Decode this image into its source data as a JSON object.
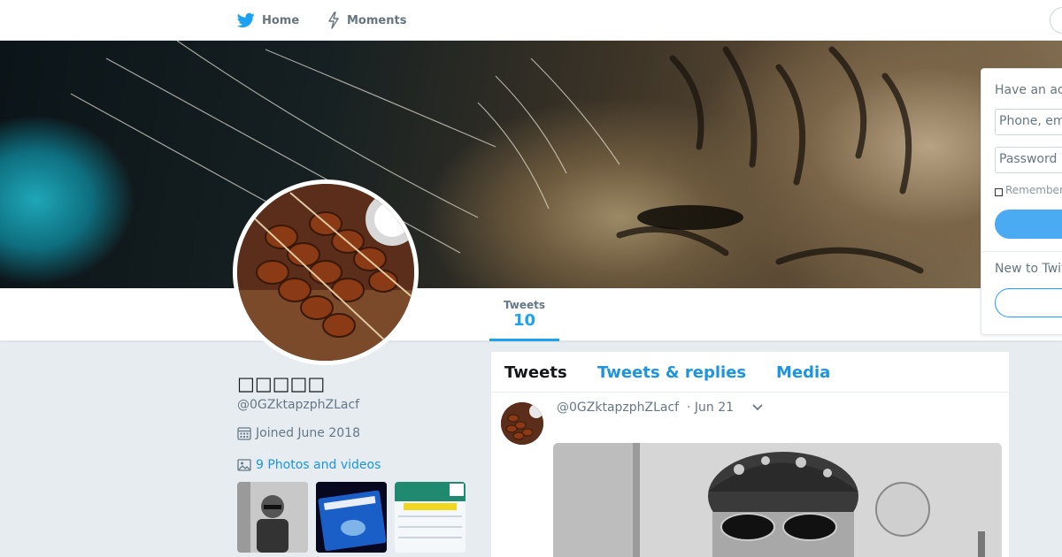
{
  "nav": {
    "home_label": "Home",
    "moments_label": "Moments",
    "home_icon": "twitter-bird-icon",
    "moments_icon": "lightning-icon"
  },
  "profile": {
    "name": "□□□□□",
    "handle": "@0GZktapzphZLacf",
    "joined": "Joined June 2018",
    "photos_link": "9 Photos and videos"
  },
  "stats": {
    "tweets_label": "Tweets",
    "tweets_count": "10"
  },
  "timeline": {
    "tabs": [
      "Tweets",
      "Tweets & replies",
      "Media"
    ],
    "tweet": {
      "handle": "@0GZktapzphZLacf",
      "date": "· Jun 21"
    }
  },
  "login": {
    "title": "Have an ac",
    "phone_placeholder": "Phone, em",
    "password_placeholder": "Password",
    "remember_label": "Remember",
    "new_title": "New to Twit"
  },
  "colors": {
    "accent": "#1da1f2",
    "link": "#1b95e0",
    "background": "#e6ecf0"
  }
}
